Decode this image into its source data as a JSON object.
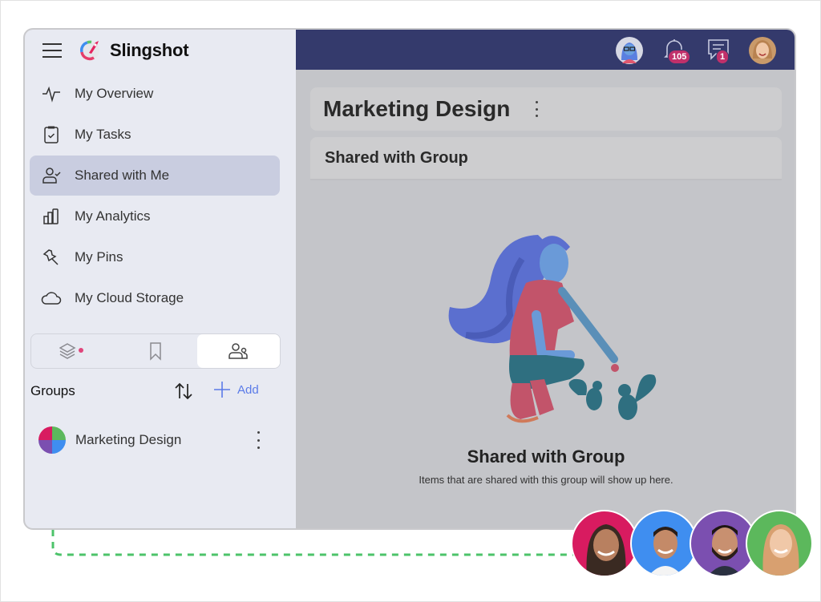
{
  "app": {
    "name": "Slingshot"
  },
  "sidebar": {
    "items": [
      {
        "label": "My Overview",
        "icon": "pulse-icon",
        "active": false
      },
      {
        "label": "My Tasks",
        "icon": "clipboard-check-icon",
        "active": false
      },
      {
        "label": "Shared with Me",
        "icon": "user-check-icon",
        "active": true
      },
      {
        "label": "My Analytics",
        "icon": "bar-chart-icon",
        "active": false
      },
      {
        "label": "My Pins",
        "icon": "pin-icon",
        "active": false
      },
      {
        "label": "My Cloud Storage",
        "icon": "cloud-icon",
        "active": false
      }
    ],
    "tabs": [
      {
        "icon": "layers-icon",
        "active": false,
        "has_dot": true
      },
      {
        "icon": "bookmark-icon",
        "active": false
      },
      {
        "icon": "users-icon",
        "active": true
      }
    ],
    "groups": {
      "title": "Groups",
      "add_label": "Add",
      "items": [
        {
          "label": "Marketing Design"
        }
      ]
    }
  },
  "topbar": {
    "notifications_count": "105",
    "messages_count": "1"
  },
  "main": {
    "title": "Marketing Design",
    "section_title": "Shared with Group",
    "empty_state": {
      "title": "Shared with Group",
      "subtitle": "Items that are shared with this group will show up here."
    }
  },
  "colors": {
    "topbar": "#343a6c",
    "sidebar_bg": "#e8eaf2",
    "active_item": "#c9cde0",
    "accent": "#5b7be8",
    "badge": "#c0306a",
    "dashed_connector": "#4cc36a"
  },
  "group_members": [
    {
      "bg": "#d81b60"
    },
    {
      "bg": "#3f8ef0"
    },
    {
      "bg": "#7b4fb0"
    },
    {
      "bg": "#5cb85c"
    }
  ]
}
